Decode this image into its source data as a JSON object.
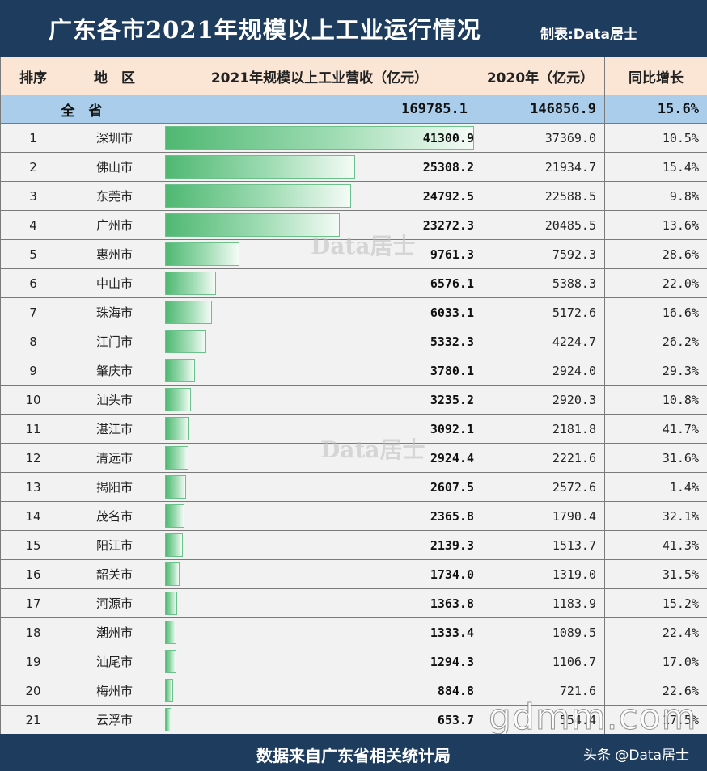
{
  "header": {
    "title": "广东各市2021年规模以上工业运行情况",
    "credit": "制表:Data居士"
  },
  "table": {
    "columns": [
      "排序",
      "地　区",
      "2021年规模以上工业营收（亿元）",
      "2020年（亿元）",
      "同比增长"
    ],
    "total": {
      "label": "全　省",
      "v2021": "169785.1",
      "v2020": "146856.9",
      "growth": "15.6%"
    }
  },
  "chart_data": {
    "type": "table",
    "title": "广东各市2021年规模以上工业运行情况",
    "columns": [
      "排序",
      "地区",
      "2021年规模以上工业营收（亿元）",
      "2020年（亿元）",
      "同比增长"
    ],
    "rows": [
      {
        "rank": "1",
        "city": "深圳市",
        "v2021": 41300.9,
        "v2020": "37369.0",
        "growth": "10.5%"
      },
      {
        "rank": "2",
        "city": "佛山市",
        "v2021": 25308.2,
        "v2020": "21934.7",
        "growth": "15.4%"
      },
      {
        "rank": "3",
        "city": "东莞市",
        "v2021": 24792.5,
        "v2020": "22588.5",
        "growth": "9.8%"
      },
      {
        "rank": "4",
        "city": "广州市",
        "v2021": 23272.3,
        "v2020": "20485.5",
        "growth": "13.6%"
      },
      {
        "rank": "5",
        "city": "惠州市",
        "v2021": 9761.3,
        "v2020": "7592.3",
        "growth": "28.6%"
      },
      {
        "rank": "6",
        "city": "中山市",
        "v2021": 6576.1,
        "v2020": "5388.3",
        "growth": "22.0%"
      },
      {
        "rank": "7",
        "city": "珠海市",
        "v2021": 6033.1,
        "v2020": "5172.6",
        "growth": "16.6%"
      },
      {
        "rank": "8",
        "city": "江门市",
        "v2021": 5332.3,
        "v2020": "4224.7",
        "growth": "26.2%"
      },
      {
        "rank": "9",
        "city": "肇庆市",
        "v2021": 3780.1,
        "v2020": "2924.0",
        "growth": "29.3%"
      },
      {
        "rank": "10",
        "city": "汕头市",
        "v2021": 3235.2,
        "v2020": "2920.3",
        "growth": "10.8%"
      },
      {
        "rank": "11",
        "city": "湛江市",
        "v2021": 3092.1,
        "v2020": "2181.8",
        "growth": "41.7%"
      },
      {
        "rank": "12",
        "city": "清远市",
        "v2021": 2924.4,
        "v2020": "2221.6",
        "growth": "31.6%"
      },
      {
        "rank": "13",
        "city": "揭阳市",
        "v2021": 2607.5,
        "v2020": "2572.6",
        "growth": "1.4%"
      },
      {
        "rank": "14",
        "city": "茂名市",
        "v2021": 2365.8,
        "v2020": "1790.4",
        "growth": "32.1%"
      },
      {
        "rank": "15",
        "city": "阳江市",
        "v2021": 2139.3,
        "v2020": "1513.7",
        "growth": "41.3%"
      },
      {
        "rank": "16",
        "city": "韶关市",
        "v2021": 1734.0,
        "v2020": "1319.0",
        "growth": "31.5%"
      },
      {
        "rank": "17",
        "city": "河源市",
        "v2021": 1363.8,
        "v2020": "1183.9",
        "growth": "15.2%"
      },
      {
        "rank": "18",
        "city": "潮州市",
        "v2021": 1333.4,
        "v2020": "1089.5",
        "growth": "22.4%"
      },
      {
        "rank": "19",
        "city": "汕尾市",
        "v2021": 1294.3,
        "v2020": "1106.7",
        "growth": "17.0%"
      },
      {
        "rank": "20",
        "city": "梅州市",
        "v2021": 884.8,
        "v2020": "721.6",
        "growth": "22.6%"
      },
      {
        "rank": "21",
        "city": "云浮市",
        "v2021": 653.7,
        "v2020": "554.4",
        "growth": "17.5%"
      }
    ],
    "bar_max": 41300.9
  },
  "footer": {
    "text": "数据来自广东省相关统计局",
    "brand": "头条 @Data居士"
  },
  "watermarks": {
    "data": "Data居士",
    "site": "gdmm.com"
  },
  "colors": {
    "header_bg": "#1e3d5e",
    "header_row_bg": "#fbe6d6",
    "total_row_bg": "#a9cdea",
    "row_bg": "#f2f2f2",
    "bar_green": "#4fb872"
  }
}
